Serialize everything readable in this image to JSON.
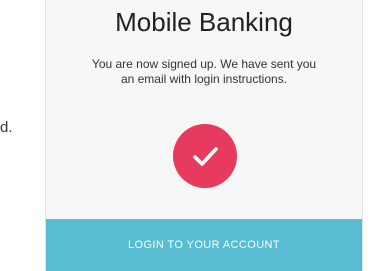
{
  "background": {
    "fragment_text": "d."
  },
  "app": {
    "title": "Mobile Banking"
  },
  "message": {
    "line1": "You are now signed up. We have sent you",
    "line2": "an email with login instructions."
  },
  "success_icon": {
    "name": "checkmark-icon",
    "color": "#e63a5e"
  },
  "login_button": {
    "label": "LOGIN TO YOUR ACCOUNT",
    "color": "#58bcd3"
  }
}
